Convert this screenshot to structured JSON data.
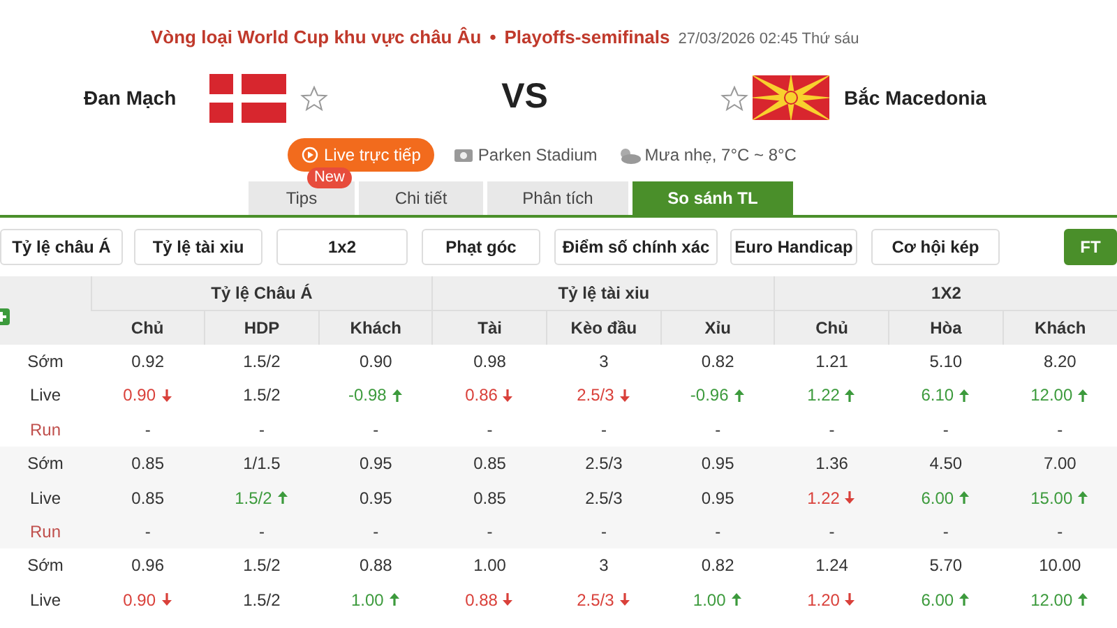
{
  "header": {
    "competition": "Vòng loại World Cup khu vực châu Âu",
    "separator": "•",
    "stage": "Playoffs-semifinals",
    "datetime": "27/03/2026 02:45 Thứ sáu"
  },
  "home": {
    "name": "Đan Mạch",
    "favorite": false
  },
  "vs": "VS",
  "away": {
    "name": "Bắc Macedonia",
    "favorite": false
  },
  "live_button": "Live trực tiếp",
  "venue": "Parken Stadium",
  "weather": "Mưa nhẹ, 7°C ~ 8°C",
  "tabs": [
    {
      "label": "Tips",
      "badge": "New",
      "selected": false
    },
    {
      "label": "Chi tiết",
      "selected": false
    },
    {
      "label": "Phân tích",
      "selected": false
    },
    {
      "label": "So sánh TL",
      "selected": true
    }
  ],
  "filters": [
    {
      "label": "Tỷ lệ châu Á"
    },
    {
      "label": "Tỷ lệ tài xiu"
    },
    {
      "label": "1x2"
    },
    {
      "label": "Phạt góc"
    },
    {
      "label": "Điểm số chính xác"
    },
    {
      "label": "Euro Handicap"
    },
    {
      "label": "Cơ hội kép"
    }
  ],
  "period_button": {
    "label": "FT",
    "selected": true
  },
  "table": {
    "groups": [
      "Tỷ lệ Châu Á",
      "Tỷ lệ tài xiu",
      "1X2"
    ],
    "columns": [
      "Chủ",
      "HDP",
      "Khách",
      "Tài",
      "Kèo đầu",
      "Xỉu",
      "Chủ",
      "Hòa",
      "Khách"
    ],
    "blocks": [
      {
        "rows": [
          {
            "label": "Sớm",
            "kind": "early",
            "cells": [
              {
                "text": "0.92"
              },
              {
                "text": "1.5/2"
              },
              {
                "text": "0.90"
              },
              {
                "text": "0.98"
              },
              {
                "text": "3"
              },
              {
                "text": "0.82"
              },
              {
                "text": "1.21"
              },
              {
                "text": "5.10"
              },
              {
                "text": "8.20"
              }
            ]
          },
          {
            "label": "Live",
            "kind": "live",
            "cells": [
              {
                "text": "0.90",
                "up": false
              },
              {
                "text": "1.5/2"
              },
              {
                "text": "-0.98",
                "up": true
              },
              {
                "text": "0.86",
                "up": false
              },
              {
                "text": "2.5/3",
                "up": false
              },
              {
                "text": "-0.96",
                "up": true
              },
              {
                "text": "1.22",
                "up": true
              },
              {
                "text": "6.10",
                "up": true
              },
              {
                "text": "12.00",
                "up": true
              }
            ]
          },
          {
            "label": "Run",
            "kind": "run",
            "cells": [
              {
                "text": "-"
              },
              {
                "text": "-"
              },
              {
                "text": "-"
              },
              {
                "text": "-"
              },
              {
                "text": "-"
              },
              {
                "text": "-"
              },
              {
                "text": "-"
              },
              {
                "text": "-"
              },
              {
                "text": "-"
              }
            ]
          }
        ]
      },
      {
        "rows": [
          {
            "label": "Sớm",
            "kind": "early",
            "cells": [
              {
                "text": "0.85"
              },
              {
                "text": "1/1.5"
              },
              {
                "text": "0.95"
              },
              {
                "text": "0.85"
              },
              {
                "text": "2.5/3"
              },
              {
                "text": "0.95"
              },
              {
                "text": "1.36"
              },
              {
                "text": "4.50"
              },
              {
                "text": "7.00"
              }
            ]
          },
          {
            "label": "Live",
            "kind": "live",
            "cells": [
              {
                "text": "0.85"
              },
              {
                "text": "1.5/2",
                "up": true
              },
              {
                "text": "0.95"
              },
              {
                "text": "0.85"
              },
              {
                "text": "2.5/3"
              },
              {
                "text": "0.95"
              },
              {
                "text": "1.22",
                "up": false
              },
              {
                "text": "6.00",
                "up": true
              },
              {
                "text": "15.00",
                "up": true
              }
            ]
          },
          {
            "label": "Run",
            "kind": "run",
            "cells": [
              {
                "text": "-"
              },
              {
                "text": "-"
              },
              {
                "text": "-"
              },
              {
                "text": "-"
              },
              {
                "text": "-"
              },
              {
                "text": "-"
              },
              {
                "text": "-"
              },
              {
                "text": "-"
              },
              {
                "text": "-"
              }
            ]
          }
        ]
      },
      {
        "rows": [
          {
            "label": "Sớm",
            "kind": "early",
            "cells": [
              {
                "text": "0.96"
              },
              {
                "text": "1.5/2"
              },
              {
                "text": "0.88"
              },
              {
                "text": "1.00"
              },
              {
                "text": "3"
              },
              {
                "text": "0.82"
              },
              {
                "text": "1.24"
              },
              {
                "text": "5.70"
              },
              {
                "text": "10.00"
              }
            ]
          },
          {
            "label": "Live",
            "kind": "live",
            "cells": [
              {
                "text": "0.90",
                "up": false
              },
              {
                "text": "1.5/2"
              },
              {
                "text": "1.00",
                "up": true
              },
              {
                "text": "0.88",
                "up": false
              },
              {
                "text": "2.5/3",
                "up": false
              },
              {
                "text": "1.00",
                "up": true
              },
              {
                "text": "1.20",
                "up": false
              },
              {
                "text": "6.00",
                "up": true
              },
              {
                "text": "12.00",
                "up": true
              }
            ]
          }
        ]
      }
    ]
  }
}
